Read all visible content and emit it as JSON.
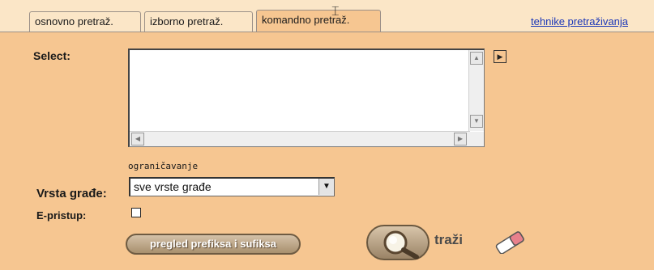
{
  "tabs": [
    {
      "label": "osnovno pretraž.",
      "active": false
    },
    {
      "label": "izborno pretraž.",
      "active": false
    },
    {
      "label": "komandno pretraž.",
      "active": true
    }
  ],
  "help_link": "tehnike pretraživanja",
  "form": {
    "select_label": "Select:",
    "select_value": "",
    "restriction_hint": "ograničavanje",
    "material_type_label": "Vrsta građe:",
    "material_type_value": "sve vrste građe",
    "eaccess_label": "E-pristup:",
    "eaccess_checked": false
  },
  "buttons": {
    "prefix_suffix": "pregled prefiksa i sufiksa",
    "search": "traži"
  },
  "icons": {
    "expand": "expand-icon",
    "search": "magnifier-icon",
    "clear": "eraser-icon",
    "cursor": "text-cursor-icon"
  },
  "colors": {
    "panel_background": "#f6c691",
    "tab_background": "#fbe6c7",
    "link": "#1a36b8"
  }
}
